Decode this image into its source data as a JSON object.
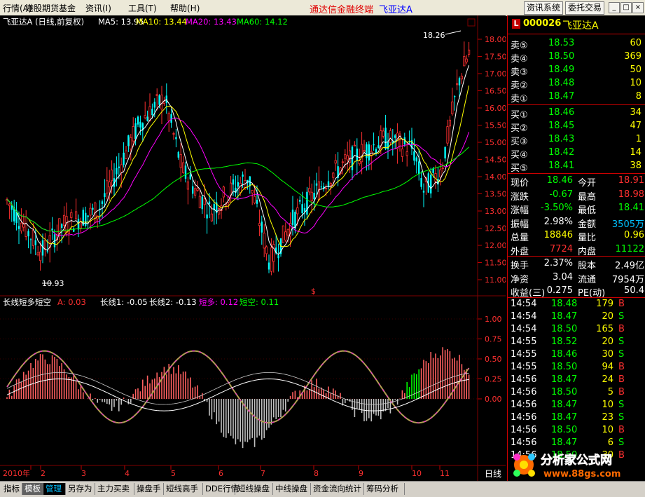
{
  "menubar": {
    "items": [
      "行情(A)",
      "港股期货基金",
      "资讯(I)",
      "工具(T)",
      "帮助(H)"
    ],
    "app_title": "通达信金融终端",
    "stock_title": "飞亚达A",
    "buttons": [
      "资讯系统",
      "委托交易"
    ],
    "window_buttons": [
      "_",
      "□",
      "×"
    ]
  },
  "main_chart": {
    "title": "飞亚达A (日线,前复权)",
    "ma_labels": [
      {
        "text": "MA5: 13.95",
        "color": "#ffffff"
      },
      {
        "text": "MA10: 13.44",
        "color": "#ffff00"
      },
      {
        "text": "MA20: 13.43",
        "color": "#ff00ff"
      },
      {
        "text": "MA60: 14.12",
        "color": "#00ff00"
      }
    ],
    "y_ticks": [
      "18.00",
      "17.50",
      "17.00",
      "16.50",
      "16.00",
      "15.50",
      "15.00",
      "14.50",
      "14.00",
      "13.50",
      "13.00",
      "12.50",
      "12.00",
      "11.50",
      "11.00"
    ],
    "high_label": "18.26",
    "low_label": "10.93",
    "marker": "$"
  },
  "indicator": {
    "name": "长线短多短空",
    "labels": [
      {
        "text": "A: 0.03",
        "color": "#ff3030"
      },
      {
        "text": "长线1: -0.05",
        "color": "#ffffff"
      },
      {
        "text": "长线2: -0.13",
        "color": "#ffffff"
      },
      {
        "text": "短多: 0.12",
        "color": "#ff00ff"
      },
      {
        "text": "短空: 0.11",
        "color": "#00ff00"
      }
    ],
    "y_ticks": [
      "1.00",
      "0.75",
      "0.50",
      "0.25",
      "0.00"
    ]
  },
  "x_axis": {
    "labels": [
      "2010年",
      "2",
      "3",
      "4",
      "5",
      "6",
      "7",
      "8",
      "9",
      "10",
      "11"
    ],
    "period": "日线"
  },
  "quote": {
    "code": "000026",
    "name": "飞亚达A",
    "badge": "L",
    "asks": [
      {
        "label": "卖⑤",
        "price": "18.53",
        "vol": "60"
      },
      {
        "label": "卖④",
        "price": "18.50",
        "vol": "369"
      },
      {
        "label": "卖③",
        "price": "18.49",
        "vol": "50"
      },
      {
        "label": "卖②",
        "price": "18.48",
        "vol": "10"
      },
      {
        "label": "卖①",
        "price": "18.47",
        "vol": "8"
      }
    ],
    "bids": [
      {
        "label": "买①",
        "price": "18.46",
        "vol": "34"
      },
      {
        "label": "买②",
        "price": "18.45",
        "vol": "47"
      },
      {
        "label": "买③",
        "price": "18.43",
        "vol": "1"
      },
      {
        "label": "买④",
        "price": "18.42",
        "vol": "14"
      },
      {
        "label": "买⑤",
        "price": "18.41",
        "vol": "38"
      }
    ],
    "stats": [
      {
        "l1": "现价",
        "v1": "18.46",
        "c1": "#00ff00",
        "l2": "今开",
        "v2": "18.91",
        "c2": "#ff3030"
      },
      {
        "l1": "涨跌",
        "v1": "-0.67",
        "c1": "#00ff00",
        "l2": "最高",
        "v2": "18.98",
        "c2": "#ff3030"
      },
      {
        "l1": "涨幅",
        "v1": "-3.50%",
        "c1": "#00ff00",
        "l2": "最低",
        "v2": "18.41",
        "c2": "#00ff00"
      },
      {
        "l1": "振幅",
        "v1": "2.98%",
        "c1": "#ffffff",
        "l2": "金额",
        "v2": "3505万",
        "c2": "#00c0ff"
      },
      {
        "l1": "总量",
        "v1": "18846",
        "c1": "#ffff00",
        "l2": "量比",
        "v2": "0.96",
        "c2": "#ffff00"
      },
      {
        "l1": "外盘",
        "v1": "7724",
        "c1": "#ff3030",
        "l2": "内盘",
        "v2": "11122",
        "c2": "#00ff00"
      }
    ],
    "stats2": [
      {
        "l1": "换手",
        "v1": "2.37%",
        "l2": "股本",
        "v2": "2.49亿"
      },
      {
        "l1": "净资",
        "v1": "3.04",
        "l2": "流通",
        "v2": "7954万"
      },
      {
        "l1": "收益(三)",
        "v1": "0.275",
        "l2": "PE(动)",
        "v2": "50.4"
      }
    ],
    "ticks": [
      {
        "time": "14:54",
        "price": "18.48",
        "vol": "179",
        "bs": "B"
      },
      {
        "time": "14:54",
        "price": "18.47",
        "vol": "20",
        "bs": "S"
      },
      {
        "time": "14:54",
        "price": "18.50",
        "vol": "165",
        "bs": "B"
      },
      {
        "time": "14:55",
        "price": "18.52",
        "vol": "20",
        "bs": "S"
      },
      {
        "time": "14:55",
        "price": "18.46",
        "vol": "30",
        "bs": "S"
      },
      {
        "time": "14:55",
        "price": "18.50",
        "vol": "94",
        "bs": "B"
      },
      {
        "time": "14:56",
        "price": "18.47",
        "vol": "24",
        "bs": "B"
      },
      {
        "time": "14:56",
        "price": "18.50",
        "vol": "5",
        "bs": "B"
      },
      {
        "time": "14:56",
        "price": "18.47",
        "vol": "10",
        "bs": "S"
      },
      {
        "time": "14:56",
        "price": "18.47",
        "vol": "23",
        "bs": "S"
      },
      {
        "time": "14:56",
        "price": "18.50",
        "vol": "10",
        "bs": "B"
      },
      {
        "time": "14:56",
        "price": "18.47",
        "vol": "6",
        "bs": "S"
      },
      {
        "time": "14:56",
        "price": "18.50",
        "vol": "30",
        "bs": "B"
      }
    ]
  },
  "tabs": [
    "指标",
    "模板",
    "管理",
    "另存为",
    "主力买卖",
    "操盘手",
    "短线高手",
    "DDE行情",
    "短线操盘",
    "中线操盘",
    "资金流向统计",
    "筹码分析"
  ],
  "active_tab": 2,
  "watermark": {
    "title": "分析家公式网",
    "url": "www.88gs.com"
  },
  "colors": {
    "up": "#ff3030",
    "down": "#00ffff",
    "grid": "#800000"
  }
}
